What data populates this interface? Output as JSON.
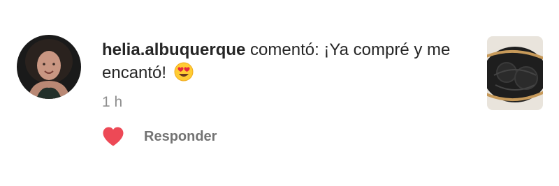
{
  "notification": {
    "username": "helia.albuquerque",
    "action_text": " comentó: ¡Ya compré y me encantó! ",
    "emoji": "😍",
    "timestamp": "1 h",
    "reply_label": "Responder",
    "liked": true
  },
  "colors": {
    "heart": "#ed4956",
    "text": "#262626",
    "muted": "#8e8e8e"
  },
  "icons": {
    "like": "heart-icon",
    "emoji": "heart-eyes-emoji-icon"
  }
}
